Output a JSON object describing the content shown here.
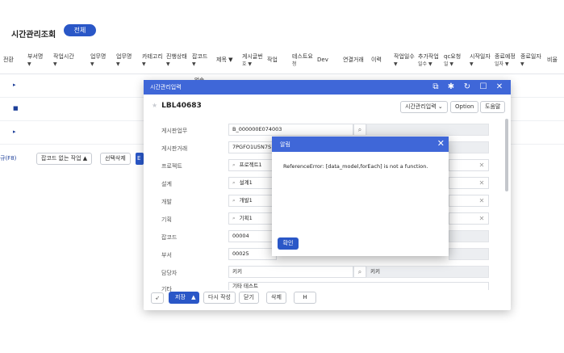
{
  "page": {
    "title": "시간관리조회",
    "filter_chip": "전체"
  },
  "table": {
    "columns": [
      {
        "label": "전환",
        "arrow": ""
      },
      {
        "label": "부서명",
        "arrow": "▼"
      },
      {
        "label": "작업시간",
        "arrow": "▼"
      },
      {
        "label": "업무명",
        "arrow": "▼"
      },
      {
        "label": "업무명",
        "arrow": "▼"
      },
      {
        "label": "카테고리",
        "arrow": "▼"
      },
      {
        "label": "진행상태",
        "arrow": "▼"
      },
      {
        "label": "잡코드",
        "arrow": "▼"
      },
      {
        "label": "제목 ▼",
        "arrow": ""
      },
      {
        "label": "게시글번",
        "arrow": "호 ▼"
      },
      {
        "label": "작업",
        "arrow": ""
      },
      {
        "label": "테스트요",
        "arrow": "청"
      },
      {
        "label": "Dev",
        "arrow": ""
      },
      {
        "label": "연결거래",
        "arrow": ""
      },
      {
        "label": "이력",
        "arrow": ""
      },
      {
        "label": "작업일수",
        "arrow": "▼"
      },
      {
        "label": "추가작업",
        "arrow": "일수 ▼"
      },
      {
        "label": "qc요청",
        "arrow": "일 ▼"
      },
      {
        "label": "시작일자",
        "arrow": "▼"
      },
      {
        "label": "종료예정",
        "arrow": "일자 ▼"
      },
      {
        "label": "종료일자",
        "arrow": "▼"
      },
      {
        "label": "비율",
        "arrow": ""
      }
    ],
    "row_marks": [
      "▸",
      "■",
      "▸"
    ],
    "overflow_text": "업습"
  },
  "toolbar": {
    "edge_label": "규(F8)",
    "no_job_code": "잡코드 없는 작업",
    "no_job_code_arrow": "▲",
    "delete_selected": "선택삭제",
    "blue_fragment": "E"
  },
  "dialog": {
    "title": "시간관리입력",
    "record_id": "LBL40683",
    "menu_select": "시간관리입력",
    "menu_arrow": "⌄",
    "option_label": "Option",
    "help_label": "도움말",
    "controls": {
      "external": "⧉",
      "pin": "✱",
      "refresh": "↻",
      "maximize": "☐",
      "close": "✕"
    },
    "fields": [
      {
        "label": "게시판업무",
        "value": "B_000000E074003"
      },
      {
        "label": "게시판거래",
        "value": "7PGFO1U5N7S1"
      },
      {
        "label": "프로젝트",
        "value": "프로젝트1"
      },
      {
        "label": "설계",
        "value": "설계1"
      },
      {
        "label": "개발",
        "value": "개발1"
      },
      {
        "label": "기획",
        "value": "기획1"
      },
      {
        "label": "잡코드",
        "value": "00004"
      },
      {
        "label": "부서",
        "value": "00025"
      },
      {
        "label": "담당자",
        "value": "키키",
        "extra": "키키"
      },
      {
        "label": "기타",
        "value": "기타 테스트"
      }
    ],
    "footer": {
      "save": "저장",
      "save_arrow": "▲",
      "rewrite": "다시 작성",
      "close": "닫기",
      "delete": "삭제",
      "h": "H"
    }
  },
  "alert": {
    "title": "알림",
    "message": "ReferenceError: [data_model,forEach] is not a function.",
    "ok": "확인",
    "close_icon": "✕"
  }
}
